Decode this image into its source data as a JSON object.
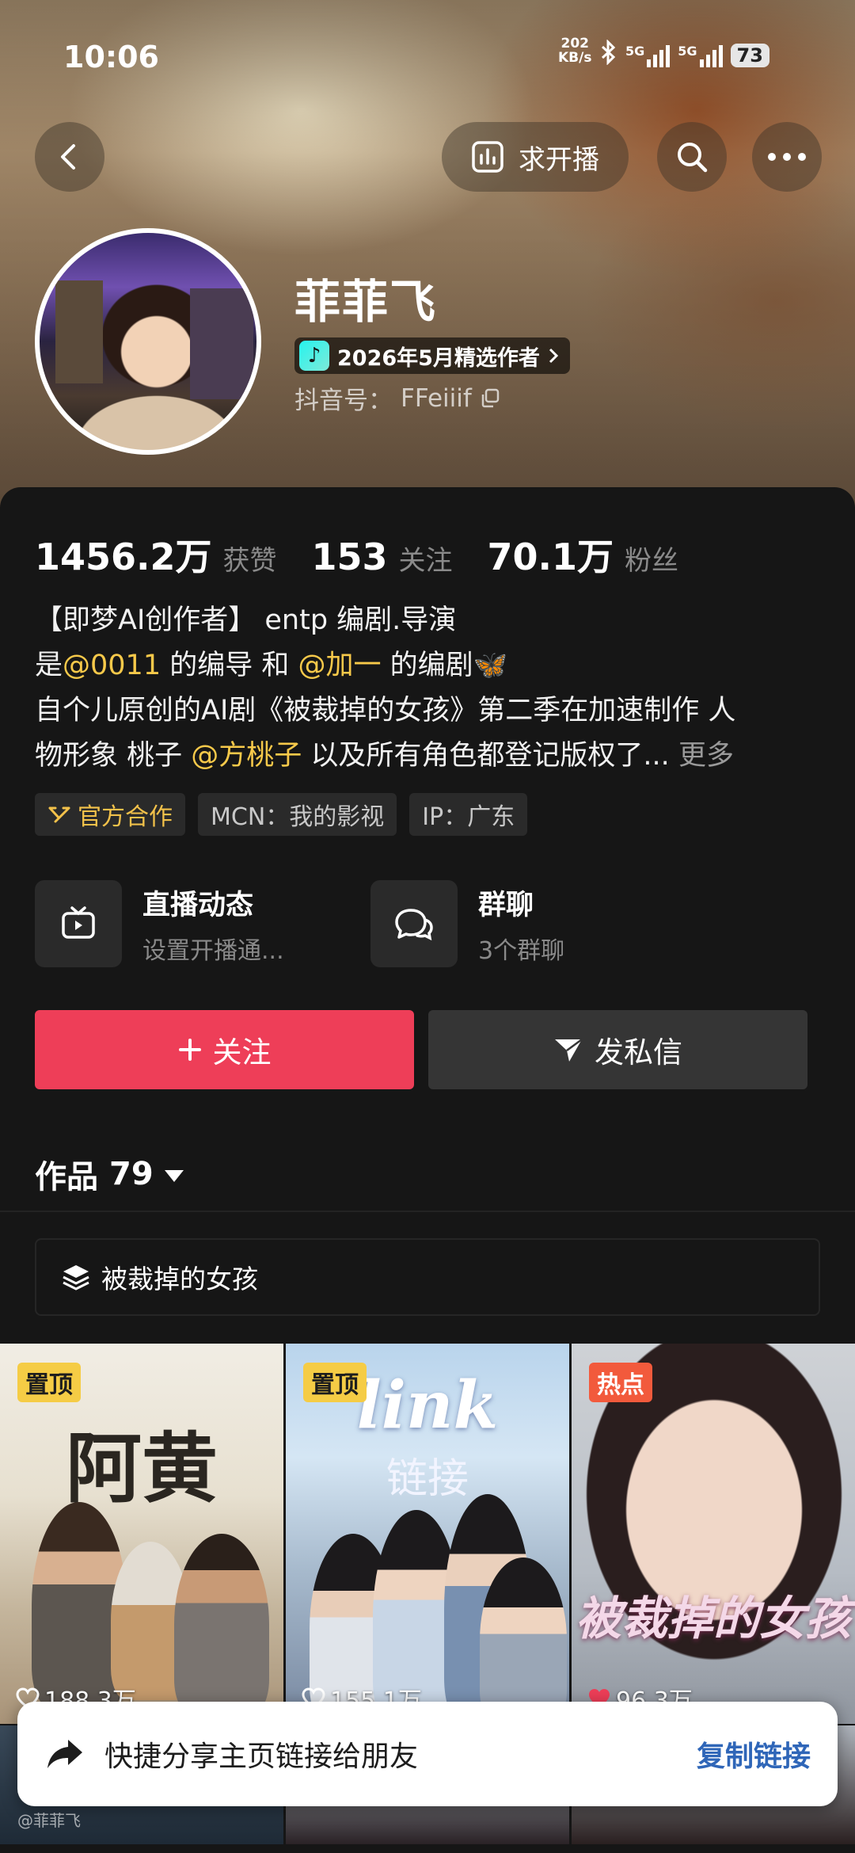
{
  "status_bar": {
    "time": "10:06",
    "net_speed_value": "202",
    "net_speed_unit": "KB/s",
    "network_1": "5G",
    "network_2": "5G",
    "battery": "73"
  },
  "nav": {
    "live_request_label": "求开播"
  },
  "profile": {
    "name": "菲菲飞",
    "badge": "2026年5月精选作者",
    "douyin_id_label": "抖音号：",
    "douyin_id": "FFeiiif"
  },
  "stats": [
    {
      "value": "1456.2万",
      "label": "获赞"
    },
    {
      "value": "153",
      "label": "关注"
    },
    {
      "value": "70.1万",
      "label": "粉丝"
    }
  ],
  "bio": {
    "line1": "【即梦AI创作者】 entp 编剧.导演",
    "line2_a": "是",
    "line2_mention1": "@0011",
    "line2_b": " 的编导 和 ",
    "line2_mention2": "@加一",
    "line2_c": " 的编剧",
    "line2_emoji": "🦋",
    "line3": "自个儿原创的AI剧《被裁掉的女孩》第二季在加速制作  人",
    "line4_a": "物形象 桃子 ",
    "line4_mention": "@方桃子",
    "line4_b": " 以及所有角色都登记版权了...",
    "more": "更多"
  },
  "tags": {
    "official": "官方合作",
    "mcn": "MCN：我的影视",
    "ip": "IP：广东"
  },
  "entries": {
    "live_title": "直播动态",
    "live_sub": "设置开播通...",
    "group_title": "群聊",
    "group_sub": "3个群聊"
  },
  "actions": {
    "follow": "关注",
    "message": "发私信"
  },
  "works": {
    "label": "作品",
    "count": "79"
  },
  "collection": {
    "label": "被裁掉的女孩"
  },
  "videos": [
    {
      "tag": "置顶",
      "title": "阿黄",
      "likes": "188.3万",
      "liked": false
    },
    {
      "tag": "置顶",
      "title": "link",
      "subtitle": "链接",
      "likes": "155.1万",
      "liked": false
    },
    {
      "tag": "热点",
      "title": "被裁掉的女孩",
      "likes": "96.3万",
      "liked": true
    }
  ],
  "share_toast": {
    "text": "快捷分享主页链接给朋友",
    "link": "复制链接"
  },
  "watermark": "@菲菲飞",
  "colors": {
    "follow": "#ee3e58",
    "mention": "#f7c94a",
    "pin": "#f5cc45",
    "hot": "#f25a3c",
    "toast_link": "#2f66b8"
  }
}
